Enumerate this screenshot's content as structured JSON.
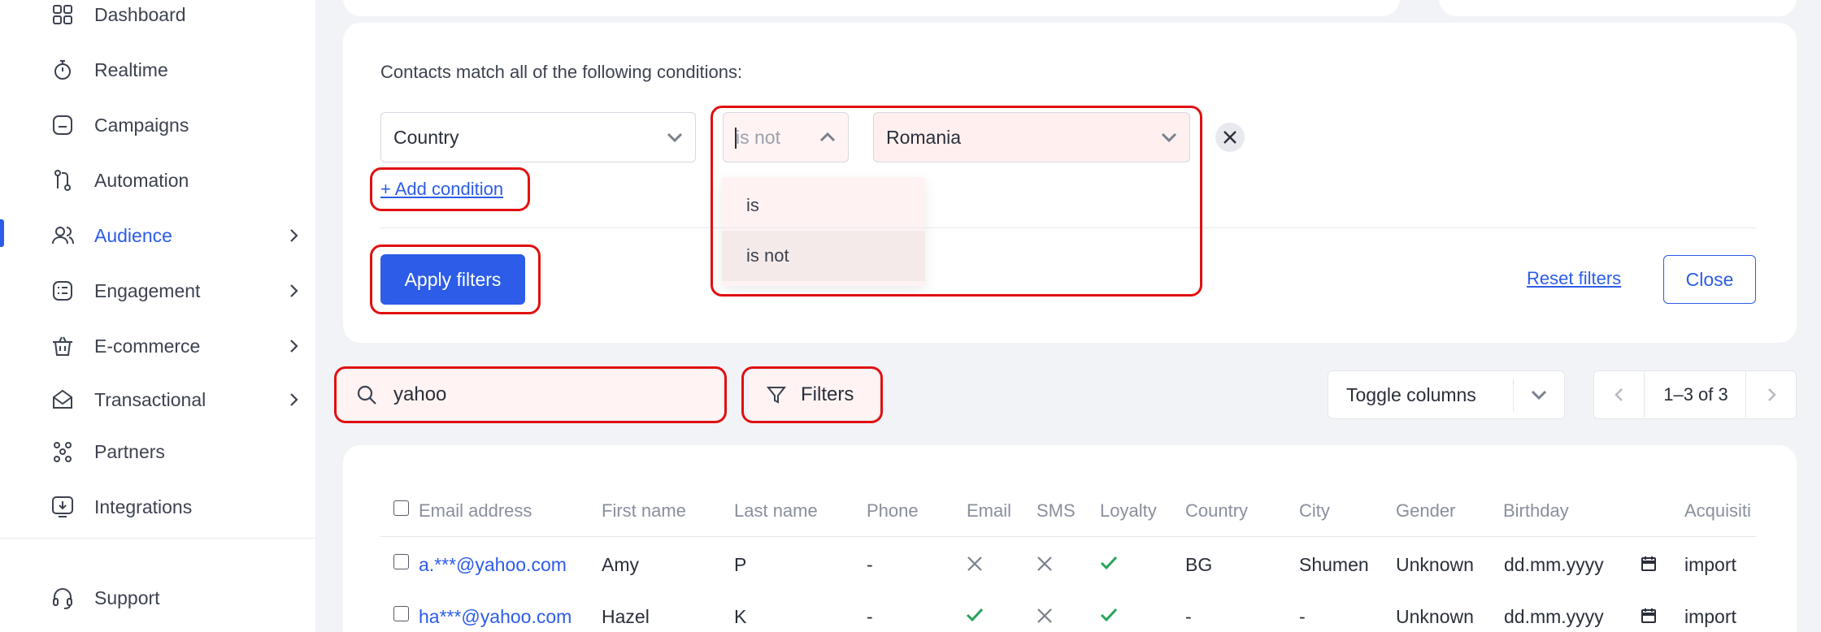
{
  "sidebar": {
    "items": [
      {
        "label": "Dashboard",
        "icon": "grid-icon"
      },
      {
        "label": "Realtime",
        "icon": "stopwatch-icon"
      },
      {
        "label": "Campaigns",
        "icon": "campaign-icon"
      },
      {
        "label": "Automation",
        "icon": "automation-icon"
      },
      {
        "label": "Audience",
        "icon": "users-icon",
        "active": true
      },
      {
        "label": "Engagement",
        "icon": "engagement-icon"
      },
      {
        "label": "E-commerce",
        "icon": "basket-icon"
      },
      {
        "label": "Transactional",
        "icon": "envelope-icon"
      },
      {
        "label": "Partners",
        "icon": "partners-icon"
      },
      {
        "label": "Integrations",
        "icon": "integrations-icon"
      }
    ],
    "support_label": "Support"
  },
  "filter": {
    "title": "Contacts match all of the following conditions:",
    "field_value": "Country",
    "operator_placeholder": "is not",
    "value": "Romania",
    "operator_options": [
      "is",
      "is not"
    ],
    "add_condition_label": "+ Add condition",
    "apply_label": "Apply filters",
    "reset_label": "Reset filters",
    "close_label": "Close"
  },
  "toolbar": {
    "search_value": "yahoo",
    "filters_label": "Filters",
    "toggle_columns_label": "Toggle columns",
    "pagination_label": "1–3 of 3"
  },
  "table": {
    "headers": [
      "Email address",
      "First name",
      "Last name",
      "Phone",
      "Email",
      "SMS",
      "Loyalty",
      "Country",
      "City",
      "Gender",
      "Birthday",
      "Acquisiti"
    ],
    "rows": [
      {
        "email": "a.***@yahoo.com",
        "first": "Amy",
        "last": "P",
        "phone": "-",
        "email_sub": "no",
        "sms_sub": "no",
        "loyalty": "yes",
        "country": "BG",
        "city": "Shumen",
        "gender": "Unknown",
        "birthday": "dd.mm.yyyy",
        "acquisition": "import"
      },
      {
        "email": "ha***@yahoo.com",
        "first": "Hazel",
        "last": "K",
        "phone": "-",
        "email_sub": "yes",
        "sms_sub": "no",
        "loyalty": "yes",
        "country": "-",
        "city": "-",
        "gender": "Unknown",
        "birthday": "dd.mm.yyyy",
        "acquisition": "import"
      }
    ]
  },
  "colors": {
    "accent": "#2c5ce8",
    "highlight": "#e01010",
    "check": "#27a35a"
  }
}
